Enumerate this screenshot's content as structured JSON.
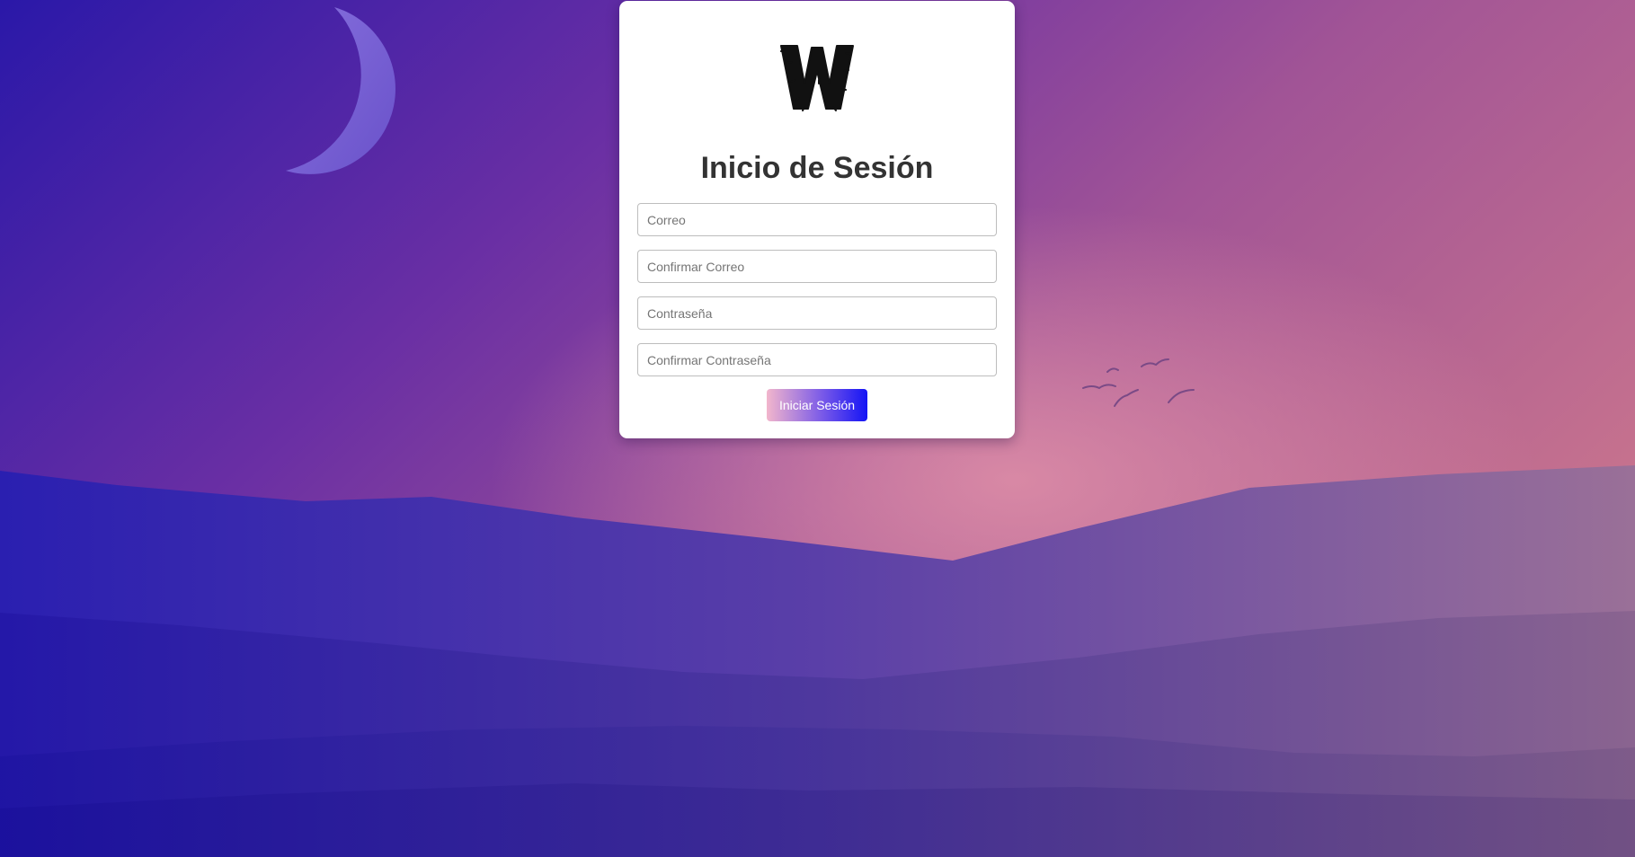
{
  "login": {
    "title": "Inicio de Sesión",
    "fields": {
      "email_placeholder": "Correo",
      "confirm_email_placeholder": "Confirmar Correo",
      "password_placeholder": "Contraseña",
      "confirm_password_placeholder": "Confirmar Contraseña"
    },
    "submit_label": "Iniciar Sesión"
  },
  "logo": {
    "icon": "w-brush-logo",
    "text": "W"
  },
  "colors": {
    "sky_top_left": "#2a18a8",
    "sky_center": "#7a3aa8",
    "sky_glow": "#d47fa0",
    "mountain_front": "#3a2b9a",
    "button_gradient_start": "#f2b6cc",
    "button_gradient_end": "#1414f5",
    "title_text": "#333333"
  }
}
